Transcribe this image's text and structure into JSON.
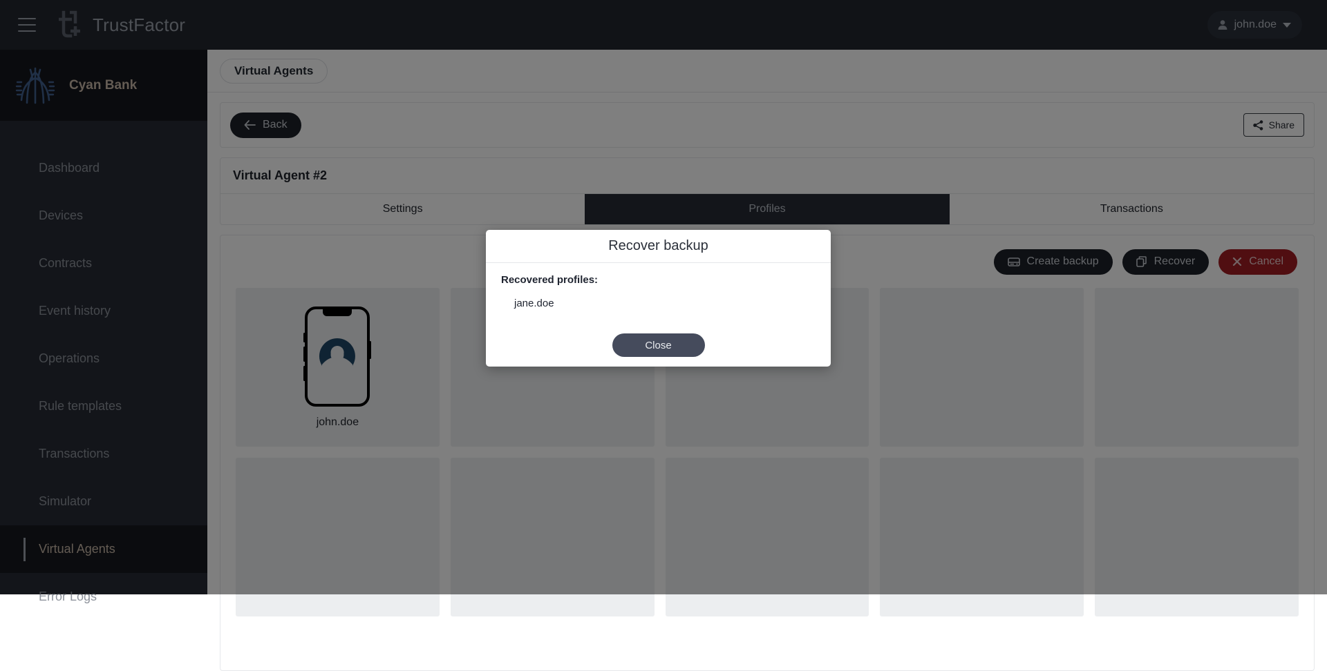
{
  "app": {
    "name": "TrustFactor",
    "menu_icon": "hamburger-icon",
    "logo_icon": "trustfactor-logo-icon"
  },
  "user": {
    "name": "john.doe",
    "avatar_icon": "user-icon",
    "chevron_icon": "chevron-down-icon"
  },
  "organization": {
    "name": "Cyan Bank",
    "logo_icon": "cyan-bank-logo-icon"
  },
  "sidebar": {
    "items": [
      {
        "label": "Dashboard",
        "active": false
      },
      {
        "label": "Devices",
        "active": false
      },
      {
        "label": "Contracts",
        "active": false
      },
      {
        "label": "Event history",
        "active": false
      },
      {
        "label": "Operations",
        "active": false
      },
      {
        "label": "Rule templates",
        "active": false
      },
      {
        "label": "Transactions",
        "active": false
      },
      {
        "label": "Simulator",
        "active": false
      },
      {
        "label": "Virtual Agents",
        "active": true
      },
      {
        "label": "Error Logs",
        "active": false
      }
    ]
  },
  "breadcrumb": {
    "label": "Virtual Agents"
  },
  "toolbar": {
    "back_label": "Back",
    "back_icon": "arrow-left-icon",
    "share_label": "Share",
    "share_icon": "share-nodes-icon"
  },
  "agent": {
    "title": "Virtual Agent #2",
    "tabs": [
      {
        "label": "Settings",
        "active": false
      },
      {
        "label": "Profiles",
        "active": true
      },
      {
        "label": "Transactions",
        "active": false
      }
    ]
  },
  "actions": {
    "create_backup_label": "Create backup",
    "create_backup_icon": "hard-drive-icon",
    "recover_label": "Recover",
    "recover_icon": "copy-icon",
    "cancel_label": "Cancel",
    "cancel_icon": "close-x-icon"
  },
  "profiles": {
    "cards": [
      {
        "label": "john.doe",
        "has_phone": true
      },
      {
        "label": "",
        "has_phone": false
      },
      {
        "label": "",
        "has_phone": false
      },
      {
        "label": "",
        "has_phone": false
      },
      {
        "label": "",
        "has_phone": false
      },
      {
        "label": "",
        "has_phone": false
      },
      {
        "label": "",
        "has_phone": false
      },
      {
        "label": "",
        "has_phone": false
      },
      {
        "label": "",
        "has_phone": false
      },
      {
        "label": "",
        "has_phone": false
      }
    ]
  },
  "modal": {
    "title": "Recover backup",
    "label": "Recovered profiles:",
    "recovered": "jane.doe",
    "close_label": "Close"
  },
  "colors": {
    "topbar": "#22262e",
    "sidebar": "#272b35",
    "sidebar_active": "#16181e",
    "accent_gold": "#c9b9a8",
    "danger": "#a01d22",
    "avatar_blue": "#1f4766",
    "logo_blue": "#41608f"
  }
}
